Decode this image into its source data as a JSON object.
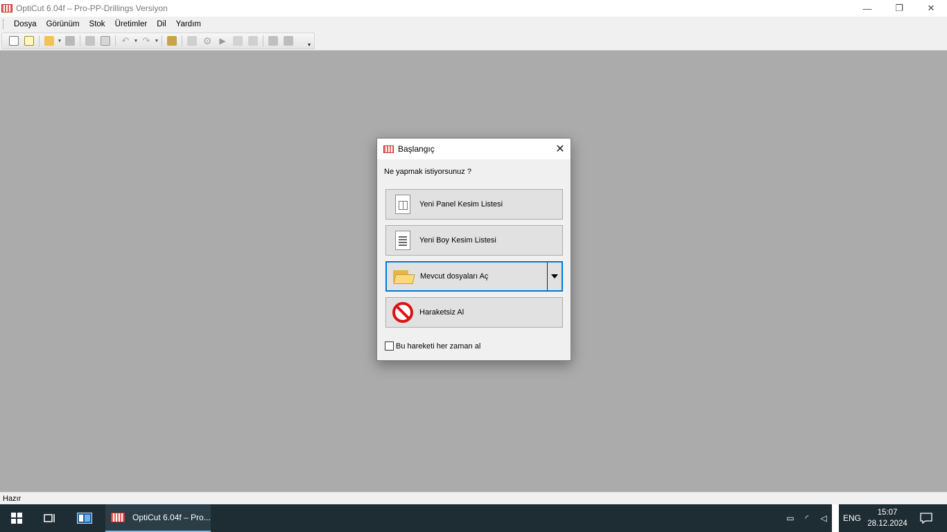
{
  "window": {
    "title": "OptiCut 6.04f – Pro-PP-Drillings Versiyon",
    "minimize": "—",
    "restore": "❐",
    "close": "✕"
  },
  "menu": {
    "items": [
      "Dosya",
      "Görünüm",
      "Stok",
      "Üretimler",
      "Dil",
      "Yardım"
    ]
  },
  "toolbar": {
    "icons": [
      "new-panel-icon",
      "new-linear-icon",
      "open-folder-icon",
      "save-icon",
      "print-icon",
      "print-preview-icon",
      "undo-icon",
      "redo-icon",
      "stock-icon",
      "edit-icon",
      "settings-icon",
      "run-icon",
      "export-icon",
      "optimize-icon",
      "report-icon",
      "tools-icon"
    ]
  },
  "status": {
    "text": "Hazır"
  },
  "dialog": {
    "title": "Başlangıç",
    "close": "✕",
    "prompt": "Ne yapmak istiyorsunuz ?",
    "buttons": {
      "new_panel": "Yeni Panel Kesim Listesi",
      "new_linear": "Yeni Boy Kesim Listesi",
      "open_existing": "Mevcut dosyaları Aç",
      "no_action": "Haraketsiz Al"
    },
    "checkbox_label": "Bu hareketi her zaman al",
    "checkbox_checked": false
  },
  "taskbar": {
    "app_label": "OptiCut 6.04f – Pro...",
    "language": "ENG",
    "time": "15:07",
    "date": "28.12.2024"
  }
}
